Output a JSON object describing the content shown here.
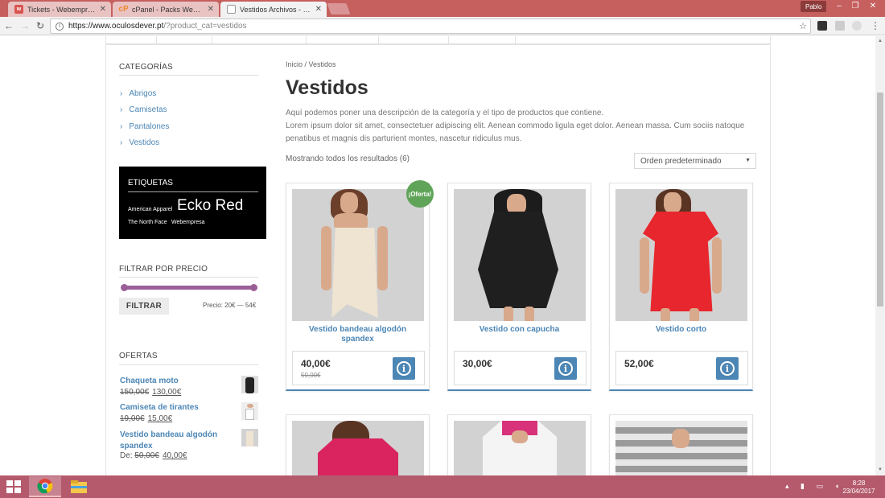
{
  "browser": {
    "tabs": [
      {
        "title": "Tickets - Webempresa Ej",
        "favicon": "tickets-favicon",
        "color": "#d9534f",
        "active": false
      },
      {
        "title": "cPanel - Packs Webempr",
        "favicon": "cpanel-favicon",
        "color": "#f0872a",
        "active": false
      },
      {
        "title": "Vestidos Archivos - Pack",
        "favicon": "page-favicon",
        "color": "#ffffff",
        "active": true
      }
    ],
    "profile": "Pablo",
    "url_host": "https://www.oculosdever.pt",
    "url_path": "/?product_cat=vestidos"
  },
  "sidebar": {
    "categories_title": "CATEGORÍAS",
    "categories": [
      "Abrigos",
      "Camisetas",
      "Pantalones",
      "Vestidos"
    ],
    "tags_title": "ETIQUETAS",
    "tags": [
      {
        "label": "American Apparel"
      },
      {
        "label": "Ecko Red"
      },
      {
        "label": "The North Face"
      },
      {
        "label": "Webempresa"
      }
    ],
    "price_filter_title": "FILTRAR POR PRECIO",
    "filter_button": "FILTRAR",
    "price_range_label": "Precio: 20€ — 54€",
    "offers_title": "OFERTAS",
    "offers": [
      {
        "name": "Chaqueta moto",
        "prefix": "",
        "old_price": "150,00€",
        "new_price": "130,00€"
      },
      {
        "name": "Camiseta de tirantes",
        "prefix": "",
        "old_price": "19,00€",
        "new_price": "15,00€"
      },
      {
        "name": "Vestido bandeau algodón spandex",
        "prefix": "De:",
        "old_price": "50,00€",
        "new_price": "40,00€"
      }
    ]
  },
  "main": {
    "breadcrumb": "Inicio / Vestidos",
    "title": "Vestidos",
    "description_1": "Aquí podemos poner una descripción de la categoría y el tipo de productos que contiene.",
    "description_2": "Lorem ipsum dolor sit amet, consectetuer adipiscing elit. Aenean commodo ligula eget dolor. Aenean massa. Cum sociis natoque penatibus et magnis dis parturient montes, nascetur ridiculus mus.",
    "result_count": "Mostrando todos los resultados (6)",
    "orderby": "Orden predeterminado",
    "sale_badge": "¡Oferta!",
    "products": [
      {
        "name": "Vestido bandeau algodón spandex",
        "price": "40,00€",
        "old_price": "50,00€",
        "on_sale": true
      },
      {
        "name": "Vestido con capucha",
        "price": "30,00€",
        "old_price": "",
        "on_sale": false
      },
      {
        "name": "Vestido corto",
        "price": "52,00€",
        "old_price": "",
        "on_sale": false
      }
    ]
  },
  "taskbar": {
    "time": "8:28",
    "date": "23/04/2017"
  },
  "colors": {
    "link": "#4c86b5",
    "slider": "#9b5f98",
    "sale": "#5fa458",
    "tabbar": "#c5605f",
    "taskbar": "#b45a6c"
  }
}
